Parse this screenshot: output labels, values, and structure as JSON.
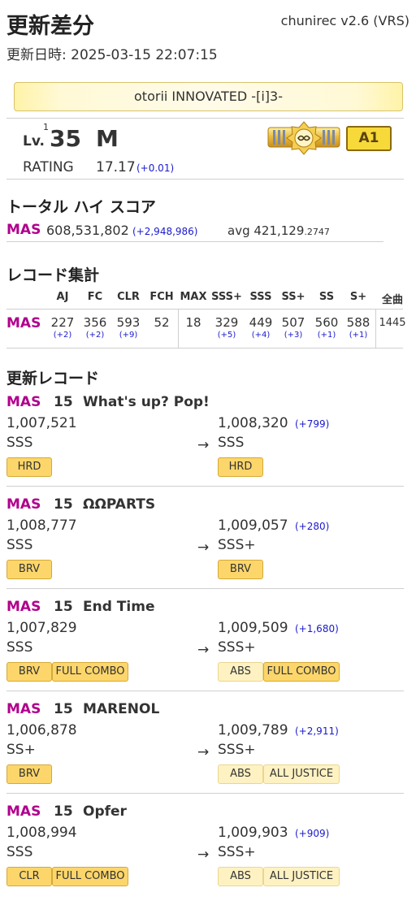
{
  "header": {
    "title": "更新差分",
    "version": "chunirec v2.6 (VRS)",
    "updated_label": "更新日時: 2025-03-15 22:07:15"
  },
  "profile": {
    "name": "otorii INNOVATED -[i]3-",
    "lv_prefix": "Lv.",
    "lv_sup": "1",
    "level": "35",
    "user": "M",
    "rating_label": "RATING",
    "rating": "17.17",
    "rating_delta": "(+0.01)",
    "class_badge": "A1"
  },
  "total_score": {
    "heading": "トータル ハイ スコア",
    "diff": "MAS",
    "value": "608,531,802",
    "delta": "(+2,948,986)",
    "avg_label": "avg 421,129",
    "avg_decimal": ".2747"
  },
  "record_stats": {
    "heading": "レコード集計",
    "diff": "MAS",
    "columns": [
      {
        "label": "AJ",
        "value": "227",
        "delta": "(+2)"
      },
      {
        "label": "FC",
        "value": "356",
        "delta": "(+2)"
      },
      {
        "label": "CLR",
        "value": "593",
        "delta": "(+9)"
      },
      {
        "label": "FCH",
        "value": "52",
        "delta": ""
      },
      {
        "label": "MAX",
        "value": "18",
        "delta": ""
      },
      {
        "label": "SSS+",
        "value": "329",
        "delta": "(+5)"
      },
      {
        "label": "SSS",
        "value": "449",
        "delta": "(+4)"
      },
      {
        "label": "SS+",
        "value": "507",
        "delta": "(+3)"
      },
      {
        "label": "SS",
        "value": "560",
        "delta": "(+1)"
      },
      {
        "label": "S+",
        "value": "588",
        "delta": "(+1)"
      },
      {
        "label": "全曲",
        "value": "1445",
        "delta": ""
      }
    ]
  },
  "updates": {
    "heading": "更新レコード",
    "arrow": "→",
    "items": [
      {
        "diff": "MAS",
        "level": "15",
        "title": "What's up? Pop!",
        "old_score": "1,007,521",
        "old_rank": "SSS",
        "new_score": "1,008,320",
        "delta": "(+799)",
        "new_rank": "SSS",
        "old_badges": [
          "HRD"
        ],
        "new_badges": [
          "HRD"
        ]
      },
      {
        "diff": "MAS",
        "level": "15",
        "title": "ΩΩPARTS",
        "old_score": "1,008,777",
        "old_rank": "SSS",
        "new_score": "1,009,057",
        "delta": "(+280)",
        "new_rank": "SSS+",
        "old_badges": [
          "BRV"
        ],
        "new_badges": [
          "BRV"
        ]
      },
      {
        "diff": "MAS",
        "level": "15",
        "title": "End Time",
        "old_score": "1,007,829",
        "old_rank": "SSS",
        "new_score": "1,009,509",
        "delta": "(+1,680)",
        "new_rank": "SSS+",
        "old_badges": [
          "BRV",
          "FULL COMBO"
        ],
        "new_badges": [
          "ABS",
          "FULL COMBO"
        ]
      },
      {
        "diff": "MAS",
        "level": "15",
        "title": "MARENOL",
        "old_score": "1,006,878",
        "old_rank": "SS+",
        "new_score": "1,009,789",
        "delta": "(+2,911)",
        "new_rank": "SSS+",
        "old_badges": [
          "BRV"
        ],
        "new_badges": [
          "ABS",
          "ALL JUSTICE"
        ]
      },
      {
        "diff": "MAS",
        "level": "15",
        "title": "Opfer",
        "old_score": "1,008,994",
        "old_rank": "SSS",
        "new_score": "1,009,903",
        "delta": "(+909)",
        "new_rank": "SSS+",
        "old_badges": [
          "CLR",
          "FULL COMBO"
        ],
        "new_badges": [
          "ABS",
          "ALL JUSTICE"
        ]
      }
    ]
  }
}
